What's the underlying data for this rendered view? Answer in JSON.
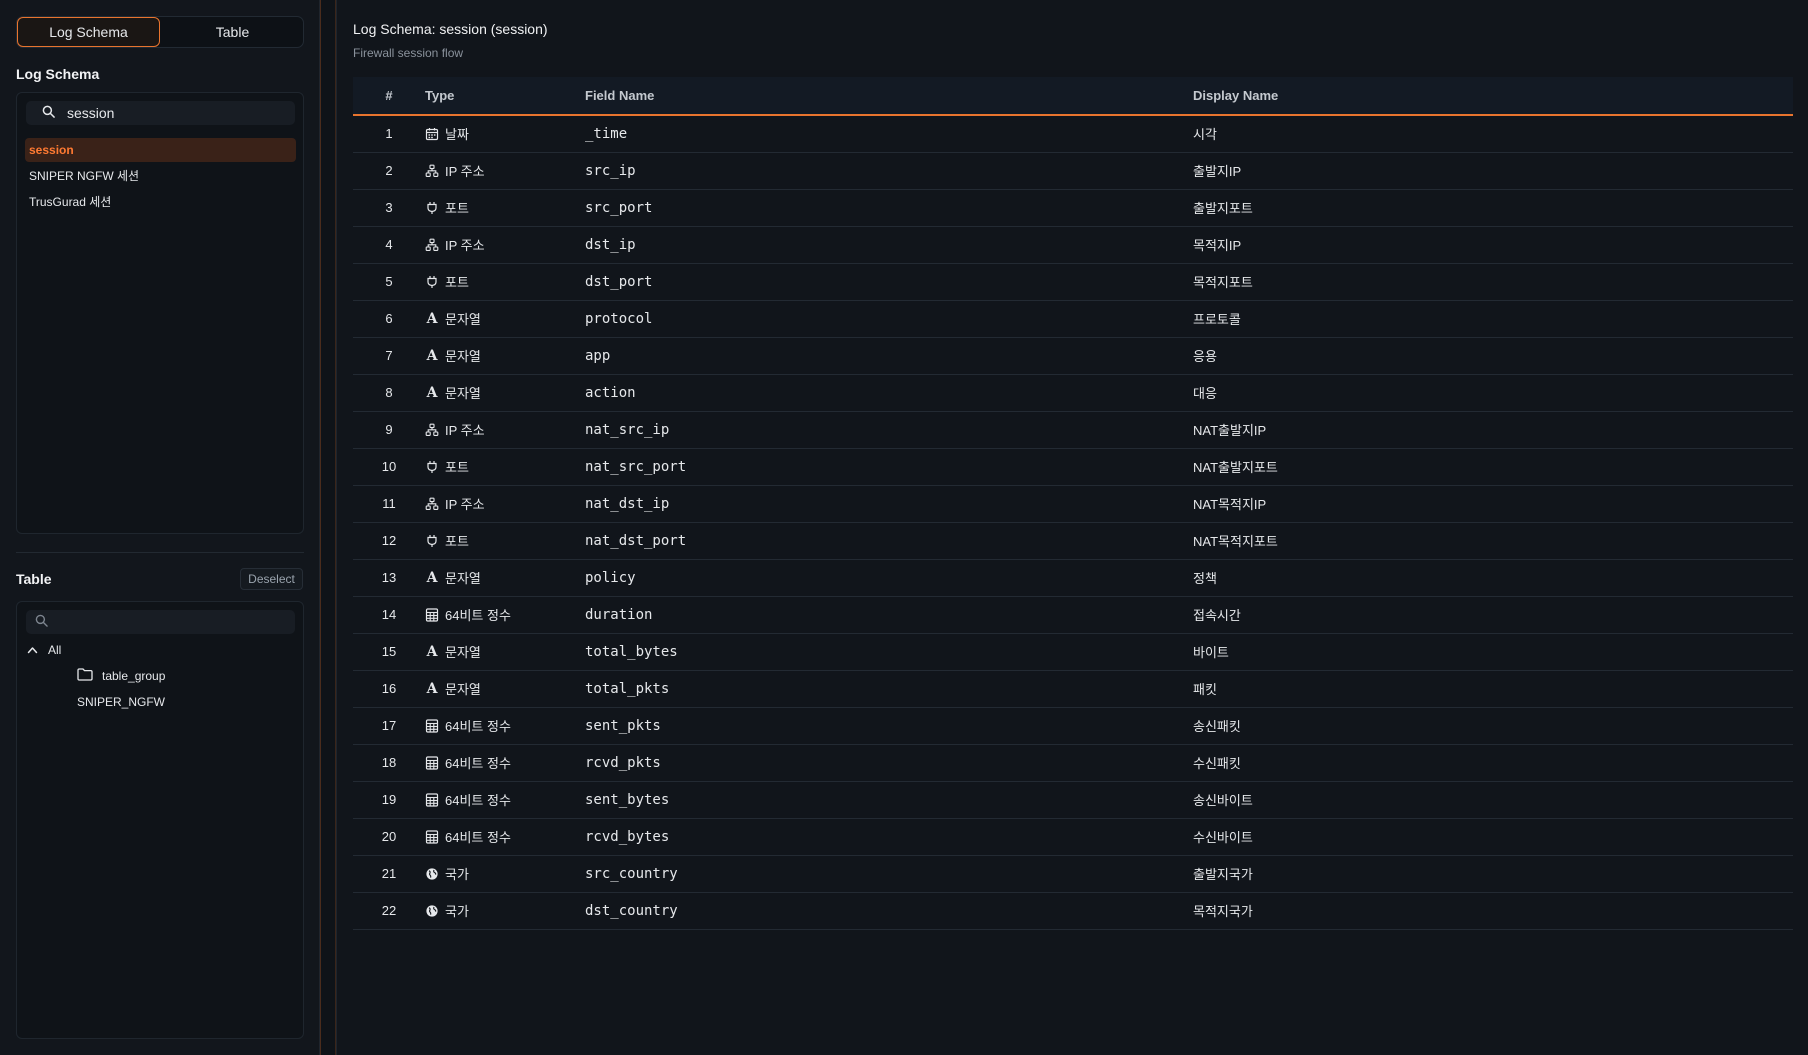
{
  "tabs": [
    {
      "label": "Log Schema",
      "active": true
    },
    {
      "label": "Table",
      "active": false
    }
  ],
  "log_schema": {
    "title": "Log Schema",
    "search_value": "session",
    "items": [
      {
        "label": "session",
        "selected": true
      },
      {
        "label": "SNIPER NGFW 세션",
        "selected": false
      },
      {
        "label": "TrusGurad 세션",
        "selected": false
      }
    ]
  },
  "table_panel": {
    "title": "Table",
    "deselect_label": "Deselect",
    "search_value": "",
    "tree": {
      "root_label": "All",
      "folder_label": "table_group",
      "leaf_label": "SNIPER_NGFW"
    }
  },
  "main": {
    "title": "Log Schema: session (session)",
    "subtitle": "Firewall session flow",
    "columns": {
      "num": "#",
      "type": "Type",
      "field": "Field Name",
      "display": "Display Name"
    },
    "rows": [
      {
        "num": "1",
        "icon": "calendar-icon",
        "type": "날짜",
        "field": "_time",
        "display": "시각"
      },
      {
        "num": "2",
        "icon": "network-icon",
        "type": "IP 주소",
        "field": "src_ip",
        "display": "출발지IP"
      },
      {
        "num": "3",
        "icon": "plug-icon",
        "type": "포트",
        "field": "src_port",
        "display": "출발지포트"
      },
      {
        "num": "4",
        "icon": "network-icon",
        "type": "IP 주소",
        "field": "dst_ip",
        "display": "목적지IP"
      },
      {
        "num": "5",
        "icon": "plug-icon",
        "type": "포트",
        "field": "dst_port",
        "display": "목적지포트"
      },
      {
        "num": "6",
        "icon": "text-icon",
        "type": "문자열",
        "field": "protocol",
        "display": "프로토콜"
      },
      {
        "num": "7",
        "icon": "text-icon",
        "type": "문자열",
        "field": "app",
        "display": "응용"
      },
      {
        "num": "8",
        "icon": "text-icon",
        "type": "문자열",
        "field": "action",
        "display": "대응"
      },
      {
        "num": "9",
        "icon": "network-icon",
        "type": "IP 주소",
        "field": "nat_src_ip",
        "display": "NAT출발지IP"
      },
      {
        "num": "10",
        "icon": "plug-icon",
        "type": "포트",
        "field": "nat_src_port",
        "display": "NAT출발지포트"
      },
      {
        "num": "11",
        "icon": "network-icon",
        "type": "IP 주소",
        "field": "nat_dst_ip",
        "display": "NAT목적지IP"
      },
      {
        "num": "12",
        "icon": "plug-icon",
        "type": "포트",
        "field": "nat_dst_port",
        "display": "NAT목적지포트"
      },
      {
        "num": "13",
        "icon": "text-icon",
        "type": "문자열",
        "field": "policy",
        "display": "정책"
      },
      {
        "num": "14",
        "icon": "calculator-icon",
        "type": "64비트 정수",
        "field": "duration",
        "display": "접속시간"
      },
      {
        "num": "15",
        "icon": "text-icon",
        "type": "문자열",
        "field": "total_bytes",
        "display": "바이트"
      },
      {
        "num": "16",
        "icon": "text-icon",
        "type": "문자열",
        "field": "total_pkts",
        "display": "패킷"
      },
      {
        "num": "17",
        "icon": "calculator-icon",
        "type": "64비트 정수",
        "field": "sent_pkts",
        "display": "송신패킷"
      },
      {
        "num": "18",
        "icon": "calculator-icon",
        "type": "64비트 정수",
        "field": "rcvd_pkts",
        "display": "수신패킷"
      },
      {
        "num": "19",
        "icon": "calculator-icon",
        "type": "64비트 정수",
        "field": "sent_bytes",
        "display": "송신바이트"
      },
      {
        "num": "20",
        "icon": "calculator-icon",
        "type": "64비트 정수",
        "field": "rcvd_bytes",
        "display": "수신바이트"
      },
      {
        "num": "21",
        "icon": "globe-icon",
        "type": "국가",
        "field": "src_country",
        "display": "출발지국가"
      },
      {
        "num": "22",
        "icon": "globe-icon",
        "type": "국가",
        "field": "dst_country",
        "display": "목적지국가"
      }
    ]
  },
  "colors": {
    "accent": "#e8742e",
    "selected_bg": "#3a2218",
    "selected_text": "#ff7a32",
    "background": "#0f1318"
  }
}
